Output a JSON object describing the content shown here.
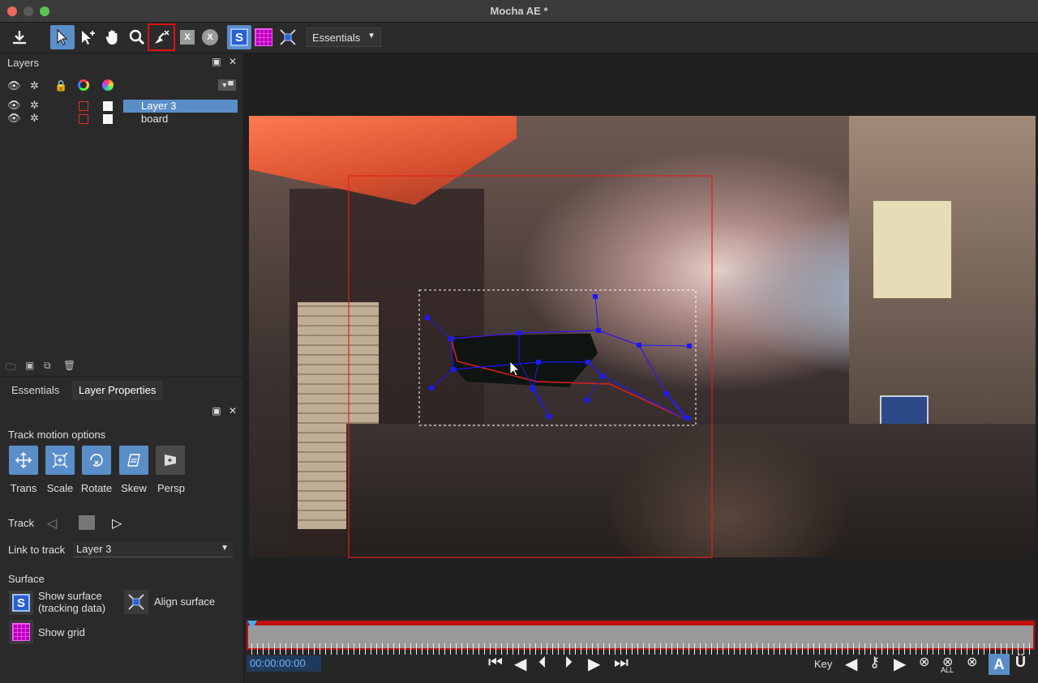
{
  "window": {
    "title": "Mocha AE *"
  },
  "toolbar": {
    "workspace": "Essentials",
    "surface_letter": "S",
    "x_label": "X"
  },
  "layers_panel": {
    "title": "Layers",
    "layers": [
      {
        "name": "Layer 3",
        "selected": true
      },
      {
        "name": "board",
        "selected": false
      }
    ]
  },
  "props_panel": {
    "tabs": [
      "Essentials",
      "Layer Properties"
    ],
    "active_tab": "Layer Properties",
    "track_motion_title": "Track motion options",
    "motion_buttons": [
      {
        "label": "Trans",
        "active": true
      },
      {
        "label": "Scale",
        "active": true
      },
      {
        "label": "Rotate",
        "active": true
      },
      {
        "label": "Skew",
        "active": true
      },
      {
        "label": "Persp",
        "active": false
      }
    ],
    "track_label": "Track",
    "link_label": "Link to track",
    "link_value": "Layer 3",
    "surface_title": "Surface",
    "show_surface_label_1": "Show surface",
    "show_surface_label_2": "(tracking data)",
    "align_surface_label": "Align surface",
    "show_grid_label": "Show grid"
  },
  "timeline": {
    "timecode": "00:00:00:00",
    "key_label": "Key",
    "all_label": "ALL",
    "a_label": "A",
    "u_label": "Ü"
  },
  "colors": {
    "accent": "#5a8ec8",
    "highlight_red": "#e01010",
    "surface_blue": "#2a5fd0",
    "grid_magenta": "#b000b0",
    "spline_blue": "#1a1aff",
    "spline_red": "#e02020"
  }
}
